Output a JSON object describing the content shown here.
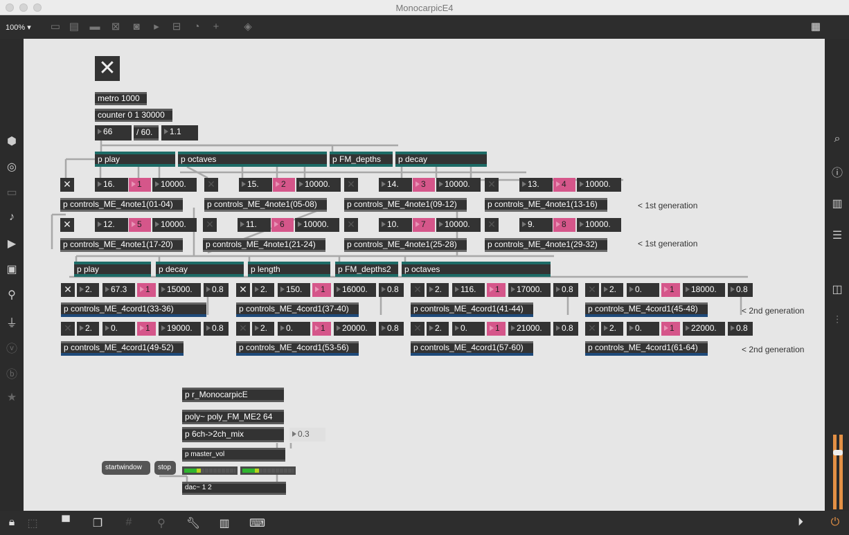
{
  "window": {
    "title": "MonocarpicE4"
  },
  "toolbar": {
    "zoom": "100%",
    "zoom_arrow": "▾"
  },
  "top": {
    "toggle": "✕",
    "metro": "metro 1000",
    "counter": "counter 0 1 30000",
    "num_counter": "66",
    "divide": "/ 60.",
    "num_ratio": "1.1"
  },
  "row1_subpatches": [
    "p play",
    "p octaves",
    "p FM_depths",
    "p decay"
  ],
  "gen1": [
    {
      "toggle": "✕",
      "pitch": "16.",
      "index": "1",
      "dur": "10000.",
      "controller": "p controls_ME_4note1(01-04)"
    },
    {
      "toggle": "✕",
      "pitch": "15.",
      "index": "2",
      "dur": "10000.",
      "controller": "p controls_ME_4note1(05-08)"
    },
    {
      "toggle": "✕",
      "pitch": "14.",
      "index": "3",
      "dur": "10000.",
      "controller": "p controls_ME_4note1(09-12)"
    },
    {
      "toggle": "✕",
      "pitch": "13.",
      "index": "4",
      "dur": "10000.",
      "controller": "p controls_ME_4note1(13-16)"
    },
    {
      "toggle": "✕",
      "pitch": "12.",
      "index": "5",
      "dur": "10000.",
      "controller": "p controls_ME_4note1(17-20)"
    },
    {
      "toggle": "✕",
      "pitch": "11.",
      "index": "6",
      "dur": "10000.",
      "controller": "p controls_ME_4note1(21-24)"
    },
    {
      "toggle": "✕",
      "pitch": "10.",
      "index": "7",
      "dur": "10000.",
      "controller": "p controls_ME_4note1(25-28)"
    },
    {
      "toggle": "✕",
      "pitch": "9.",
      "index": "8",
      "dur": "10000.",
      "controller": "p controls_ME_4note1(29-32)"
    }
  ],
  "gen1_labels": [
    "< 1st generation",
    "< 1st generation"
  ],
  "row2_subpatches": [
    "p play",
    "p decay",
    "p length",
    "p FM_depths2",
    "p octaves"
  ],
  "gen2": [
    {
      "toggle": "✕",
      "a": "2.",
      "b": "67.3",
      "index": "1",
      "dur": "15000.",
      "amp": "0.8",
      "controller": "p controls_ME_4cord1(33-36)"
    },
    {
      "toggle": "✕",
      "a": "2.",
      "b": "150.",
      "index": "1",
      "dur": "16000.",
      "amp": "0.8",
      "controller": "p controls_ME_4cord1(37-40)"
    },
    {
      "toggle": "✕",
      "a": "2.",
      "b": "116.",
      "index": "1",
      "dur": "17000.",
      "amp": "0.8",
      "controller": "p controls_ME_4cord1(41-44)"
    },
    {
      "toggle": "✕",
      "a": "2.",
      "b": "0.",
      "index": "1",
      "dur": "18000.",
      "amp": "0.8",
      "controller": "p controls_ME_4cord1(45-48)"
    },
    {
      "toggle": "✕",
      "a": "2.",
      "b": "0.",
      "index": "1",
      "dur": "19000.",
      "amp": "0.8",
      "controller": "p controls_ME_4cord1(49-52)"
    },
    {
      "toggle": "✕",
      "a": "2.",
      "b": "0.",
      "index": "1",
      "dur": "20000.",
      "amp": "0.8",
      "controller": "p controls_ME_4cord1(53-56)"
    },
    {
      "toggle": "✕",
      "a": "2.",
      "b": "0.",
      "index": "1",
      "dur": "21000.",
      "amp": "0.8",
      "controller": "p controls_ME_4cord1(57-60)"
    },
    {
      "toggle": "✕",
      "a": "2.",
      "b": "0.",
      "index": "1",
      "dur": "22000.",
      "amp": "0.8",
      "controller": "p controls_ME_4cord1(61-64)"
    }
  ],
  "gen2_labels": [
    "< 2nd generation",
    "< 2nd generation"
  ],
  "audio": {
    "receive": "p r_MonocarpicE",
    "poly": "poly~ poly_FM_ME2 64",
    "mix": "p 6ch->2ch_mix",
    "vol_value": "0.3",
    "master": "p master_vol",
    "startwindow": "startwindow",
    "stop": "stop",
    "dac": "dac~ 1 2",
    "meter_levels": [
      0.3,
      0.3
    ]
  },
  "colors": {
    "canvas": "#e6e6e6",
    "object": "#333333",
    "pink": "#d5568a",
    "teal": "#1d6b66",
    "blue": "#1e4a7a"
  }
}
